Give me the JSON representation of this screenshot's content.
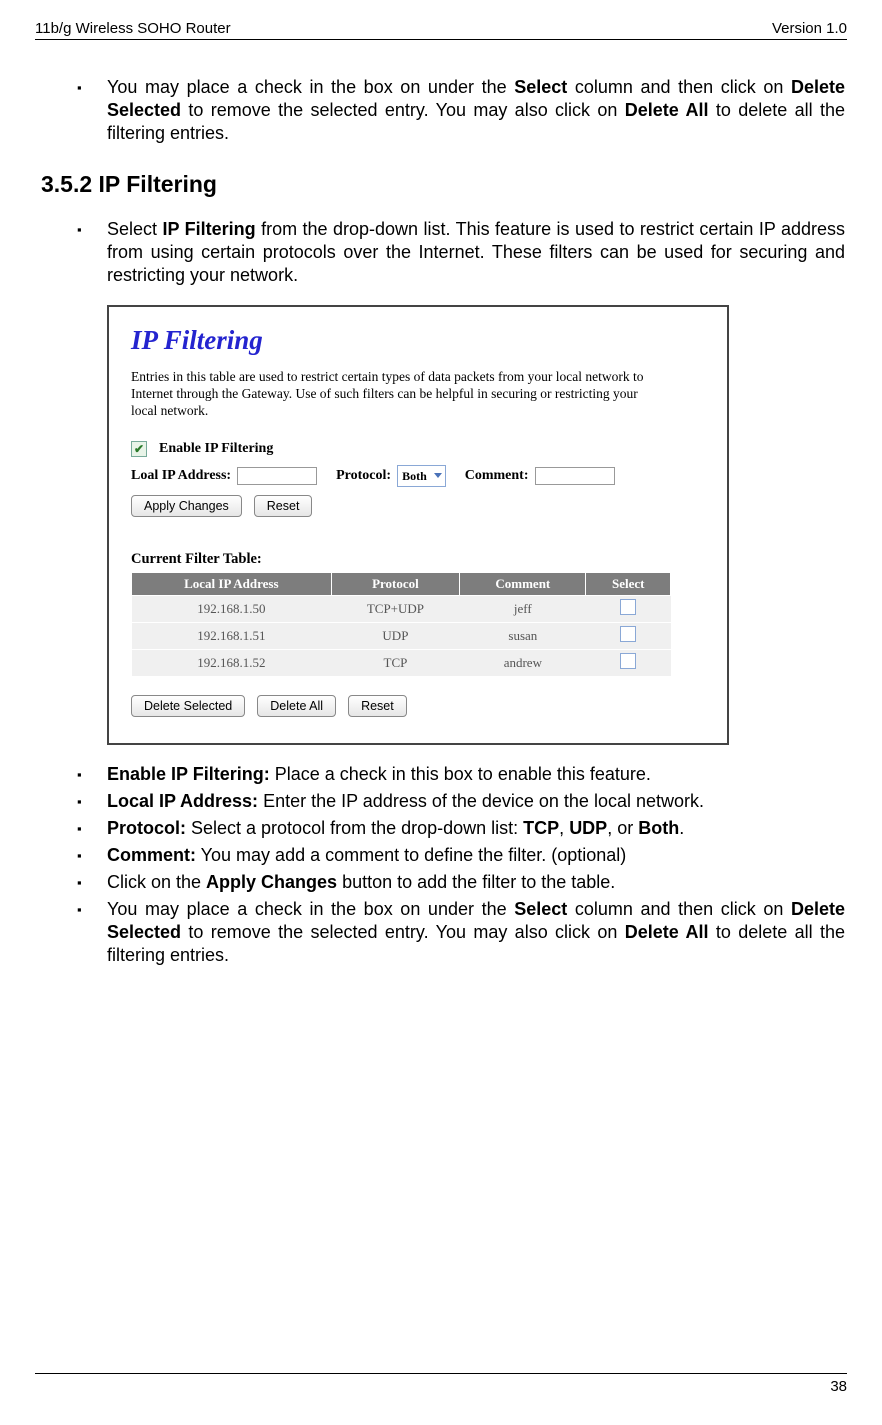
{
  "header": {
    "left": "11b/g Wireless SOHO Router",
    "right": "Version 1.0"
  },
  "footer": {
    "page": "38"
  },
  "top_bullet": {
    "pre": "You may place a check in the box on under the ",
    "b1": "Select",
    "mid1": " column and then click on ",
    "b2": "Delete Selected",
    "mid2": " to remove the selected entry. You may also click on ",
    "b3": "Delete All",
    "post": " to delete all the filtering entries."
  },
  "section_title": "3.5.2 IP Filtering",
  "intro_bullet": {
    "pre": "Select ",
    "b1": "IP Filtering",
    "post": " from the drop-down list. This feature is used to restrict certain IP address from using certain protocols over the Internet. These filters can be used for securing and restricting your network."
  },
  "screenshot": {
    "title": "IP Filtering",
    "desc": "Entries in this table are used to restrict certain types of data packets from your local network to Internet through the Gateway. Use of such filters can be helpful in securing or restricting your local network.",
    "enable_label": "Enable IP Filtering",
    "local_ip_label": "Loal IP Address:",
    "protocol_label": "Protocol:",
    "protocol_value": "Both",
    "comment_label": "Comment:",
    "btn_apply": "Apply Changes",
    "btn_reset": "Reset",
    "table_title": "Current Filter Table:",
    "headers": [
      "Local IP Address",
      "Protocol",
      "Comment",
      "Select"
    ],
    "rows": [
      {
        "ip": "192.168.1.50",
        "proto": "TCP+UDP",
        "comment": "jeff"
      },
      {
        "ip": "192.168.1.51",
        "proto": "UDP",
        "comment": "susan"
      },
      {
        "ip": "192.168.1.52",
        "proto": "TCP",
        "comment": "andrew"
      }
    ],
    "btn_delete_selected": "Delete Selected",
    "btn_delete_all": "Delete All",
    "btn_reset2": "Reset"
  },
  "lower_bullets": {
    "b1": {
      "label": "Enable IP Filtering:",
      "text": " Place a check in this box to enable this feature."
    },
    "b2": {
      "label": "Local IP Address:",
      "text": " Enter the IP address of the device on the local network."
    },
    "b3": {
      "label": "Protocol:",
      "text_pre": " Select a protocol from the drop-down list: ",
      "p1": "TCP",
      "sep1": ", ",
      "p2": "UDP",
      "sep2": ", or ",
      "p3": "Both",
      "post": "."
    },
    "b4": {
      "label": "Comment:",
      "text": " You may add a comment to define the filter. (optional)"
    },
    "b5": {
      "pre": "Click on the ",
      "label": "Apply Changes",
      "post": " button to add the filter to the table."
    },
    "b6": {
      "pre": "You may place a check in the box on under the ",
      "b1": "Select",
      "mid1": " column and then click on ",
      "b2": "Delete Selected",
      "mid2": " to remove the selected entry. You may also click on ",
      "b3": "Delete All",
      "post": " to delete all the filtering entries."
    }
  }
}
